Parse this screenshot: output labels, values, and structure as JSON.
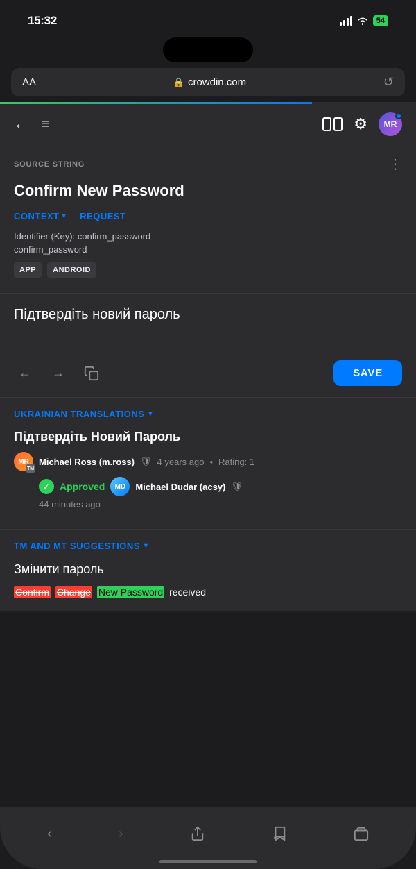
{
  "statusBar": {
    "time": "15:32",
    "battery": "54",
    "batteryIcon": "battery-icon"
  },
  "browserBar": {
    "aa": "AA",
    "url": "crowdin.com",
    "lockIcon": "🔒",
    "reload": "↺"
  },
  "toolbar": {
    "back": "←",
    "menu": "≡",
    "settings": "⚙",
    "avatarInitials": "MR"
  },
  "sourceString": {
    "sectionLabel": "SOURCE STRING",
    "text": "Confirm New Password",
    "moreIcon": "⋮"
  },
  "tabs": {
    "context": "CONTEXT",
    "request": "REQUEST"
  },
  "context": {
    "identifier": "Identifier (Key): confirm_password",
    "key": "confirm_password",
    "tags": [
      "APP",
      "ANDROID"
    ]
  },
  "translationInput": {
    "text": "Підтвердіть новий пароль",
    "saveButton": "SAVE"
  },
  "ukrainianTranslations": {
    "sectionLabel": "UKRAINIAN TRANSLATIONS",
    "items": [
      {
        "text": "Підтвердіть Новий Пароль",
        "author": "Michael Ross (m.ross)",
        "timeAgo": "4 years ago",
        "rating": "Rating: 1",
        "verifiedIcon": "✓",
        "approvedBy": "Michael Dudar (acsy)",
        "approvedLabel": "Approved",
        "approvedTime": "44 minutes ago"
      }
    ]
  },
  "suggestions": {
    "sectionLabel": "TM AND MT SUGGESTIONS",
    "items": [
      {
        "text": "Змінити пароль"
      }
    ]
  },
  "bottomBar": {
    "back": "<",
    "forward": ">",
    "share": "share",
    "bookmarks": "book",
    "tabs": "tabs"
  }
}
